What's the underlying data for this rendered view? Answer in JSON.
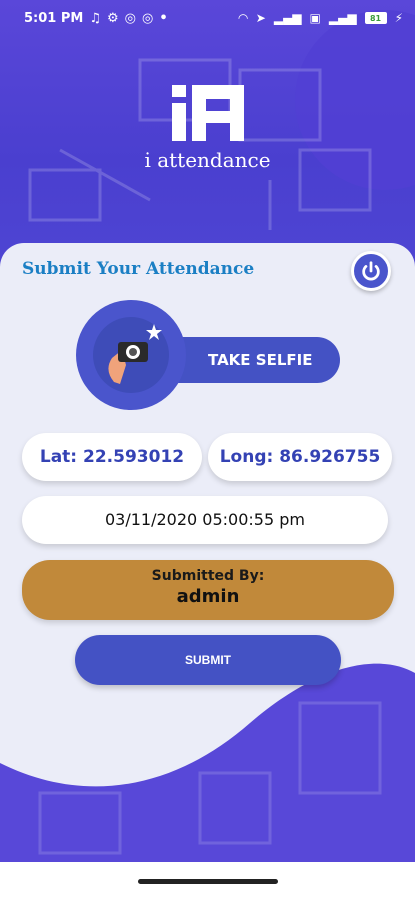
{
  "status_bar": {
    "time": "5:01 PM",
    "battery": "81"
  },
  "header": {
    "logo_icon": "ia-logo-icon",
    "app_title": "i attendance"
  },
  "card": {
    "title": "Submit Your Attendance",
    "power_icon": "power-icon"
  },
  "selfie": {
    "label": "TAKE SELFIE",
    "icon": "camera-hand-icon"
  },
  "location": {
    "lat": "Lat: 22.593012",
    "long": "Long: 86.926755"
  },
  "datetime": "03/11/2020 05:00:55 pm",
  "submitted_by": {
    "label": "Submitted By:",
    "value": "admin"
  },
  "submit_button": "SUBMIT",
  "colors": {
    "primary": "#4452c4",
    "header": "#5848d8",
    "accent_gold": "#c1893a",
    "title_blue": "#1b7fc4"
  }
}
